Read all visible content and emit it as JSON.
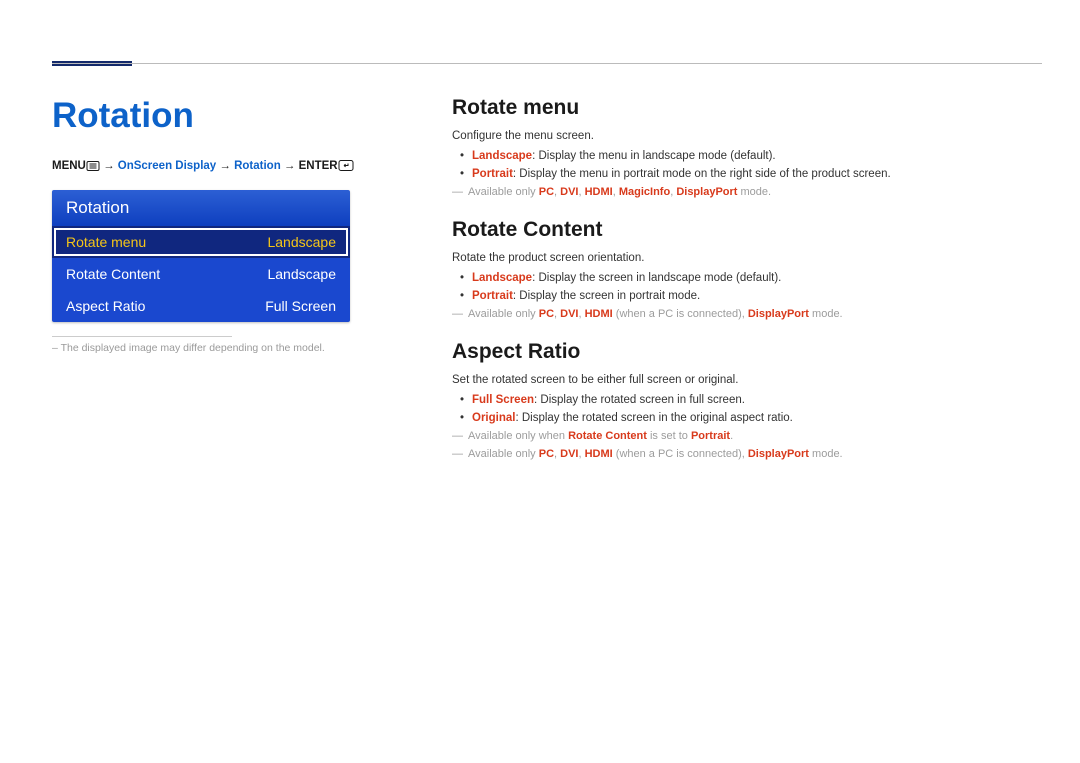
{
  "page_title": "Rotation",
  "breadcrumb": {
    "menu": "MENU",
    "arrow": " → ",
    "items": [
      "OnScreen Display",
      "Rotation"
    ],
    "enter": "ENTER"
  },
  "osd": {
    "title": "Rotation",
    "rows": [
      {
        "label": "Rotate menu",
        "value": "Landscape",
        "selected": true
      },
      {
        "label": "Rotate Content",
        "value": "Landscape",
        "selected": false
      },
      {
        "label": "Aspect Ratio",
        "value": "Full Screen",
        "selected": false
      }
    ]
  },
  "caption": "The displayed image may differ depending on the model.",
  "sections": {
    "rotate_menu": {
      "title": "Rotate menu",
      "desc": "Configure the menu screen.",
      "b1_hl": "Landscape",
      "b1_rest": ": Display the menu in landscape mode (default).",
      "b2_hl": "Portrait",
      "b2_rest": ": Display the menu in portrait mode on the right side of the product screen.",
      "note_pre": "Available only ",
      "note_hl": [
        "PC",
        "DVI",
        "HDMI",
        "MagicInfo",
        "DisplayPort"
      ],
      "note_post": " mode."
    },
    "rotate_content": {
      "title": "Rotate Content",
      "desc": "Rotate the product screen orientation.",
      "b1_hl": "Landscape",
      "b1_rest": ": Display the screen in landscape mode (default).",
      "b2_hl": "Portrait",
      "b2_rest": ": Display the screen in portrait mode.",
      "note_pre": "Available only ",
      "note_hl1": "PC",
      "note_hl2": "DVI",
      "note_hl3": "HDMI",
      "note_mid": " (when a PC is connected), ",
      "note_hl4": "DisplayPort",
      "note_post": " mode."
    },
    "aspect_ratio": {
      "title": "Aspect Ratio",
      "desc": "Set the rotated screen to be either full screen or original.",
      "b1_hl": "Full Screen",
      "b1_rest": ": Display the rotated screen in full screen.",
      "b2_hl": "Original",
      "b2_rest": ": Display the rotated screen in the original aspect ratio.",
      "note1_pre": "Available only when ",
      "note1_hl1": "Rotate Content",
      "note1_mid": " is set to ",
      "note1_hl2": "Portrait",
      "note1_post": ".",
      "note2_pre": "Available only ",
      "note2_hl1": "PC",
      "note2_hl2": "DVI",
      "note2_hl3": "HDMI",
      "note2_mid": " (when a PC is connected), ",
      "note2_hl4": "DisplayPort",
      "note2_post": " mode."
    }
  }
}
